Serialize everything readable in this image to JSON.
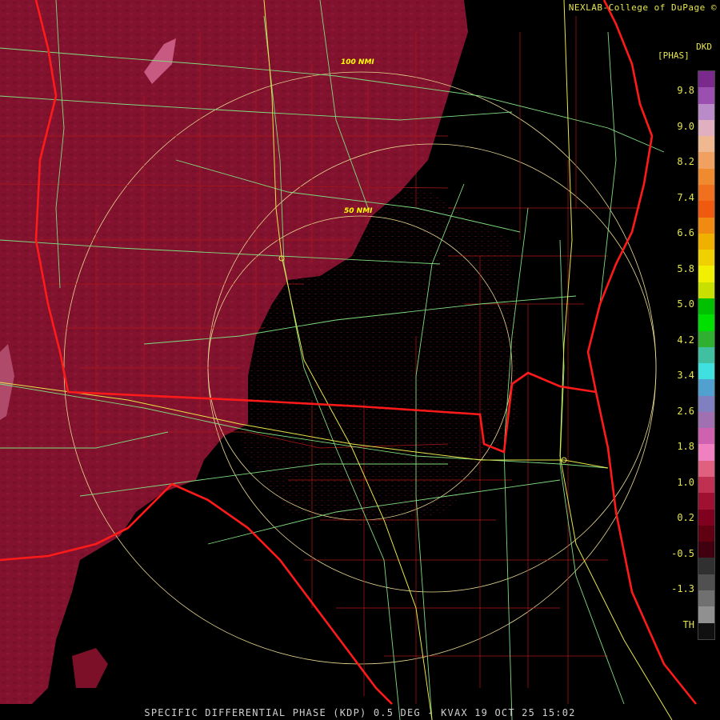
{
  "header": {
    "credit": "NEXLAB-College of DuPage",
    "credit_suffix": "©"
  },
  "legend": {
    "unit_title": "DKD",
    "unit_sub": "[PHAS]",
    "ticks": [
      "9.8",
      "9.0",
      "8.2",
      "7.4",
      "6.6",
      "5.8",
      "5.0",
      "4.2",
      "3.4",
      "2.6",
      "1.8",
      "1.0",
      "0.2",
      "-0.5",
      "-1.3",
      "TH"
    ],
    "colors": [
      "#7a2a8c",
      "#9b4fb0",
      "#b98bc8",
      "#e0b0c0",
      "#f0b890",
      "#f0a060",
      "#f08a30",
      "#f07020",
      "#f05a10",
      "#f08a10",
      "#f0b000",
      "#f0d000",
      "#f0f000",
      "#c8e000",
      "#00c000",
      "#00e000",
      "#30b030",
      "#40c0a0",
      "#40e0e0",
      "#50a0d0",
      "#8080c0",
      "#a070b0",
      "#d060b0",
      "#f080c0",
      "#e06080",
      "#c03050",
      "#a01030",
      "#800020",
      "#600010",
      "#400010",
      "#303030",
      "#505050",
      "#707070",
      "#909090",
      "#101010"
    ]
  },
  "map": {
    "range_labels": [
      "100 NMI",
      "50 NMI"
    ]
  },
  "footer": {
    "caption": "SPECIFIC DIFFERENTIAL PHASE (KDP) 0.5 DEG - KVAX 19 OCT 25 15:02"
  }
}
